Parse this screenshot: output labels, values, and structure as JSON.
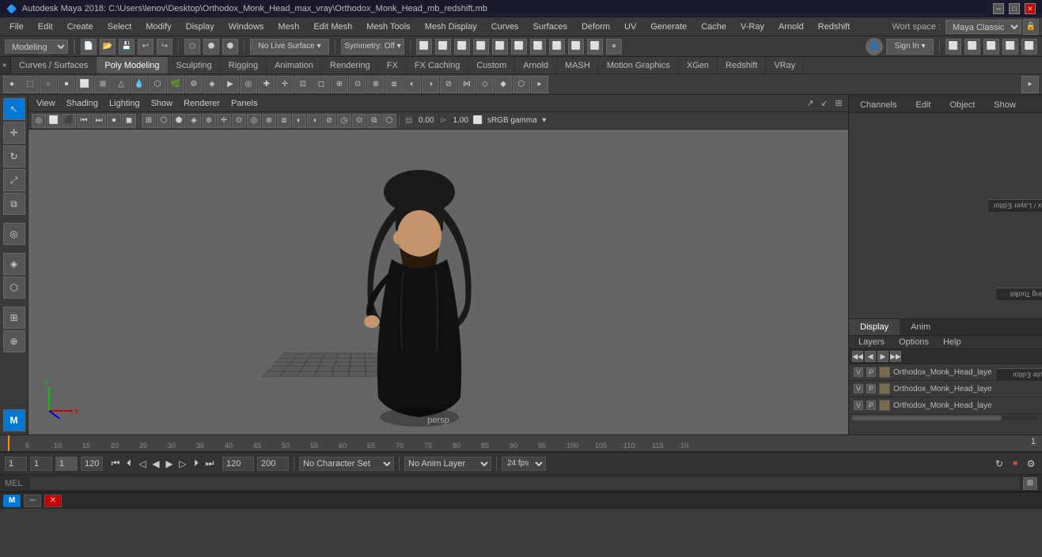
{
  "titlebar": {
    "title": "Autodesk Maya 2018: C:\\Users\\lenov\\Desktop\\Orthodox_Monk_Head_max_vray\\Orthodox_Monk_Head_mb_redshift.mb",
    "app_icon": "M"
  },
  "menubar": {
    "items": [
      "File",
      "Edit",
      "Create",
      "Select",
      "Modify",
      "Display",
      "Windows",
      "Mesh",
      "Edit Mesh",
      "Mesh Tools",
      "Mesh Display",
      "Curves",
      "Surfaces",
      "Deform",
      "UV",
      "Generate",
      "Cache",
      "V-Ray",
      "Arnold",
      "Redshift"
    ]
  },
  "workspace": {
    "label": "Wort space :",
    "value": "Maya Classic"
  },
  "toolbar_left": {
    "mode_label": "Modeling"
  },
  "tabs": {
    "items": [
      "Curves / Surfaces",
      "Poly Modeling",
      "Sculpting",
      "Rigging",
      "Animation",
      "Rendering",
      "FX",
      "FX Caching",
      "Custom",
      "Arnold",
      "MASH",
      "Motion Graphics",
      "XGen",
      "Redshift",
      "VRay"
    ]
  },
  "viewport": {
    "menu_items": [
      "View",
      "Shading",
      "Lighting",
      "Show",
      "Renderer",
      "Panels"
    ],
    "label": "persp",
    "gamma_label": "sRGB gamma",
    "camera_values": {
      "val1": "0.00",
      "val2": "1.00"
    }
  },
  "right_panel": {
    "tabs": [
      "Display",
      "Anim"
    ],
    "active_tab": "Display",
    "header_items": [
      "Channels",
      "Edit",
      "Object",
      "Show"
    ],
    "layers_header": [
      "Layers",
      "Options",
      "Help"
    ],
    "layer_icons": [
      "◀",
      "◁",
      "▷",
      "▶"
    ],
    "layers": [
      {
        "v": "V",
        "p": "P",
        "label": "Orthodox_Monk_Head_laye"
      },
      {
        "v": "V",
        "p": "P",
        "label": "Orthodox_Monk_Head_laye"
      },
      {
        "v": "V",
        "p": "P",
        "label": "Orthodox_Monk_Head_laye"
      }
    ]
  },
  "side_tabs": [
    "Channel Box / Layer Editor",
    "Modelling Toolkit",
    "Attribute Editor"
  ],
  "timeline": {
    "ticks": [
      "5",
      "10",
      "15",
      "20",
      "25",
      "30",
      "35",
      "40",
      "45",
      "50",
      "55",
      "60",
      "65",
      "70",
      "75",
      "80",
      "85",
      "90",
      "95",
      "100",
      "105",
      "110",
      "115",
      "10"
    ],
    "frame_number": "1"
  },
  "statusbar": {
    "current_frame": "1",
    "start_frame": "1",
    "slider_value": "1",
    "end_frame": "120",
    "range_start": "120",
    "range_end": "200",
    "no_character_set": "No Character Set",
    "no_anim_layer": "No Anim Layer",
    "fps": "24 fps"
  },
  "cmdline": {
    "type": "MEL",
    "placeholder": ""
  },
  "taskbar": {
    "maya_label": "M",
    "close_label": "×"
  }
}
